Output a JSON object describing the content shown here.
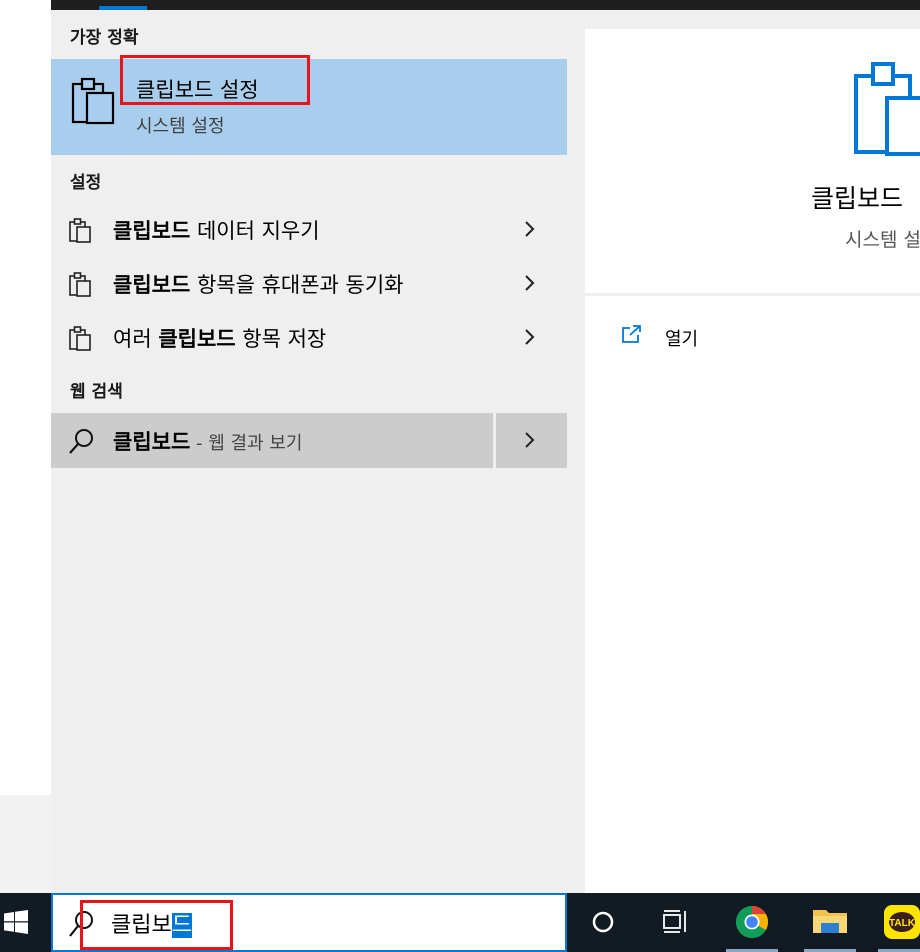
{
  "best_match": {
    "section_label": "가장 정확",
    "title": "클립보드 설정",
    "subtitle": "시스템 설정"
  },
  "settings": {
    "section_label": "설정",
    "items": [
      {
        "label_bold": "클립보드",
        "label_rest": " 데이터 지우기"
      },
      {
        "label_bold": "클립보드",
        "label_rest": " 항목을 휴대폰과 동기화"
      },
      {
        "label_prefix": "여러 ",
        "label_bold": "클립보드",
        "label_rest": " 항목 저장"
      }
    ]
  },
  "web_search": {
    "section_label": "웹 검색",
    "query": "클립보드",
    "suffix": " - 웹 결과 보기"
  },
  "detail": {
    "title": "클립보드",
    "subtitle": "시스템 설",
    "open_label": "열기"
  },
  "taskbar": {
    "search_text": "클립보",
    "search_selected": "드",
    "app_icons": [
      "cortana-icon",
      "task-view-icon",
      "chrome-icon",
      "file-explorer-icon",
      "kakaotalk-icon"
    ],
    "kakaotalk_label": "TALK"
  },
  "colors": {
    "highlight": "#a9cdec",
    "accent": "#0078d7",
    "annotation": "#e8141a",
    "taskbar": "#121a24"
  }
}
